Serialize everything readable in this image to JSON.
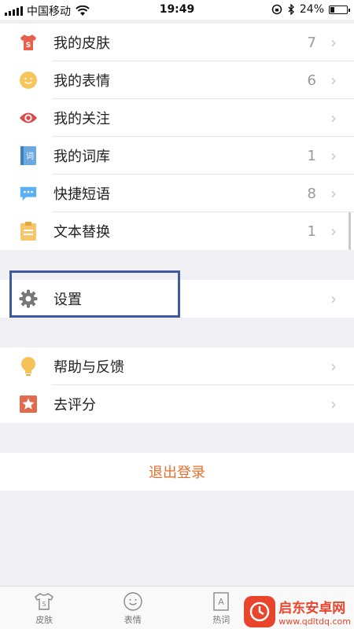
{
  "status_bar": {
    "carrier": "中国移动",
    "time": "19:49",
    "battery": "24%",
    "battery_level": 0.24,
    "icons": [
      "signal-icon",
      "wifi-icon",
      "rotation-lock-icon",
      "bluetooth-icon",
      "battery-icon"
    ]
  },
  "menu_group_1": [
    {
      "label": "我的皮肤",
      "count": "7",
      "icon": "skin-shirt-icon",
      "color": "#e8604c"
    },
    {
      "label": "我的表情",
      "count": "6",
      "icon": "smiley-icon",
      "color": "#f6c65b"
    },
    {
      "label": "我的关注",
      "count": "",
      "icon": "eye-icon",
      "color": "#d94a4a"
    },
    {
      "label": "我的词库",
      "count": "1",
      "icon": "dictionary-book-icon",
      "color": "#6aa8e0"
    },
    {
      "label": "快捷短语",
      "count": "8",
      "icon": "chat-bubble-icon",
      "color": "#5ab0f0"
    },
    {
      "label": "文本替换",
      "count": "1",
      "icon": "clipboard-icon",
      "color": "#f6c66a"
    }
  ],
  "settings": {
    "label": "设置",
    "icon": "gear-icon",
    "color": "#777777"
  },
  "menu_group_3": [
    {
      "label": "帮助与反馈",
      "icon": "lightbulb-icon",
      "color": "#f6c25a"
    },
    {
      "label": "去评分",
      "icon": "star-icon",
      "color": "#e26a4e"
    }
  ],
  "logout_label": "退出登录",
  "tabs": [
    {
      "label": "皮肤",
      "icon": "skin-shirt-icon"
    },
    {
      "label": "表情",
      "icon": "smiley-icon"
    },
    {
      "label": "热词",
      "icon": "hot-words-icon"
    },
    {
      "label": "",
      "icon": "me-icon"
    }
  ],
  "watermark": {
    "title": "启东安卓网",
    "url": "www.qdltdq.com"
  },
  "colors": {
    "accent": "#e5702e",
    "highlight": "#3d5aa1",
    "background": "#efeff4"
  }
}
